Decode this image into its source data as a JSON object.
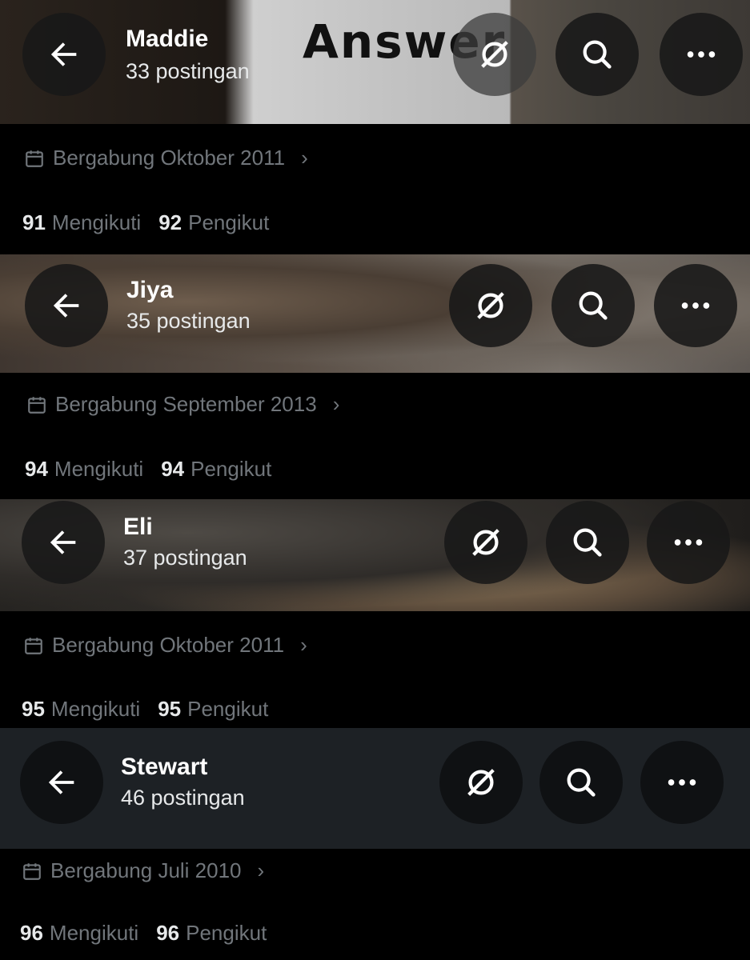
{
  "profiles": [
    {
      "name": "Maddie",
      "posts": "33 postingan",
      "banner_text": "Answer",
      "joined": "Bergabung Oktober 2011",
      "following_count": "91",
      "following_label": "Mengikuti",
      "followers_count": "92",
      "followers_label": "Pengikut"
    },
    {
      "name": "Jiya",
      "posts": "35 postingan",
      "joined": "Bergabung September 2013",
      "following_count": "94",
      "following_label": "Mengikuti",
      "followers_count": "94",
      "followers_label": "Pengikut"
    },
    {
      "name": "Eli",
      "posts": "37 postingan",
      "joined": "Bergabung Oktober 2011",
      "following_count": "95",
      "following_label": "Mengikuti",
      "followers_count": "95",
      "followers_label": "Pengikut"
    },
    {
      "name": "Stewart",
      "posts": "46 postingan",
      "joined": "Bergabung Juli 2010",
      "following_count": "96",
      "following_label": "Mengikuti",
      "followers_count": "96",
      "followers_label": "Pengikut"
    }
  ],
  "icons": {
    "back": "back-arrow-icon",
    "grok": "grok-icon",
    "search": "search-icon",
    "more": "more-icon",
    "calendar": "calendar-icon",
    "chevron": "chevron-right-icon"
  },
  "colors": {
    "background": "#000000",
    "text_primary": "#e7e9ea",
    "text_secondary": "#71767b",
    "button_bg": "#181818"
  }
}
